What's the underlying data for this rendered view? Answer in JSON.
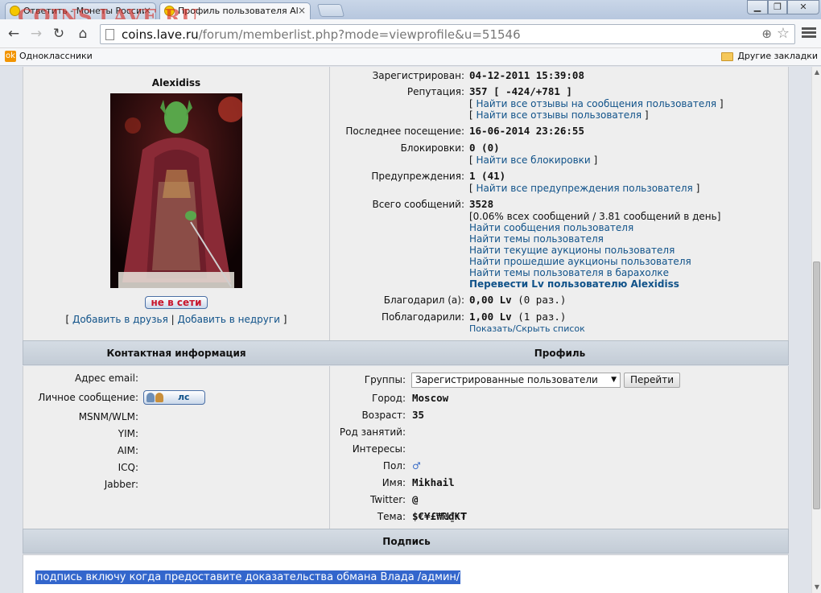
{
  "browser": {
    "tabs": [
      {
        "title": "Ответить - Монеты России",
        "active": false
      },
      {
        "title": "Профиль пользователя Ale",
        "active": true
      }
    ],
    "watermark": "COINS.LAVE.RU",
    "url_host": "coins.lave.ru",
    "url_path": "/forum/memberlist.php?mode=viewprofile&u=51546",
    "bookmarks": {
      "left": "Одноклассники",
      "right": "Другие закладки"
    }
  },
  "profile": {
    "username": "Alexidiss",
    "status_button": "не в сети",
    "add_friend": "Добавить в друзья",
    "add_foe": "Добавить в недруги",
    "bracket_open": "[",
    "bracket_sep": "|",
    "bracket_close": "]"
  },
  "stats": {
    "registered_label": "Зарегистрирован:",
    "registered_value": "04-12-2011 15:39:08",
    "reputation_label": "Репутация:",
    "reputation_value": "357 [ -424/+781 ]",
    "rep_link1": "Найти все отзывы на сообщения пользователя",
    "rep_link2": "Найти все отзывы пользователя",
    "last_visit_label": "Последнее посещение:",
    "last_visit_value": "16-06-2014 23:26:55",
    "blocks_label": "Блокировки:",
    "blocks_value": "0 (0)",
    "blocks_link": "Найти все блокировки",
    "warnings_label": "Предупреждения:",
    "warnings_value": "1 (41)",
    "warnings_link": "Найти все предупреждения пользователя",
    "posts_label": "Всего сообщений:",
    "posts_value": "3528",
    "posts_detail": "[0.06% всех сообщений / 3.81 сообщений в день]",
    "posts_links": [
      "Найти сообщения пользователя",
      "Найти темы пользователя",
      "Найти текущие аукционы пользователя",
      "Найти прошедшие аукционы пользователя",
      "Найти темы пользователя в барахолке"
    ],
    "transfer_link": "Перевести Lv пользователю Alexidiss",
    "thanked_label": "Благодарил (а):",
    "thanked_value": "0,00 Lv",
    "thanked_count": "(0 раз.)",
    "was_thanked_label": "Поблагодарили:",
    "was_thanked_value": "1,00 Lv",
    "was_thanked_count": "(1 раз.)",
    "toggle_list": "Показать/Скрыть список"
  },
  "contact": {
    "header": "Контактная информация",
    "email_label": "Адрес email:",
    "pm_label": "Личное сообщение:",
    "pm_button": "лс",
    "msnm_label": "MSNM/WLM:",
    "yim_label": "YIM:",
    "aim_label": "AIM:",
    "icq_label": "ICQ:",
    "jabber_label": "Jabber:"
  },
  "profile_info": {
    "header": "Профиль",
    "groups_label": "Группы:",
    "groups_selected": "Зарегистрированные пользователи",
    "go_button": "Перейти",
    "city_label": "Город:",
    "city_value": "Moscow",
    "age_label": "Возраст:",
    "age_value": "35",
    "occupation_label": "Род занятий:",
    "interests_label": "Интересы:",
    "gender_label": "Пол:",
    "gender_icon": "male-icon",
    "name_label": "Имя:",
    "name_value": "Mikhail",
    "twitter_label": "Twitter:",
    "twitter_value": "@",
    "theme_label": "Тема:",
    "theme_value": "$€¥£₩₪₫₭₮"
  },
  "signature": {
    "header": "Подпись",
    "text": "подпись включу когда предоставите доказательства обмана Влада /админ/"
  }
}
